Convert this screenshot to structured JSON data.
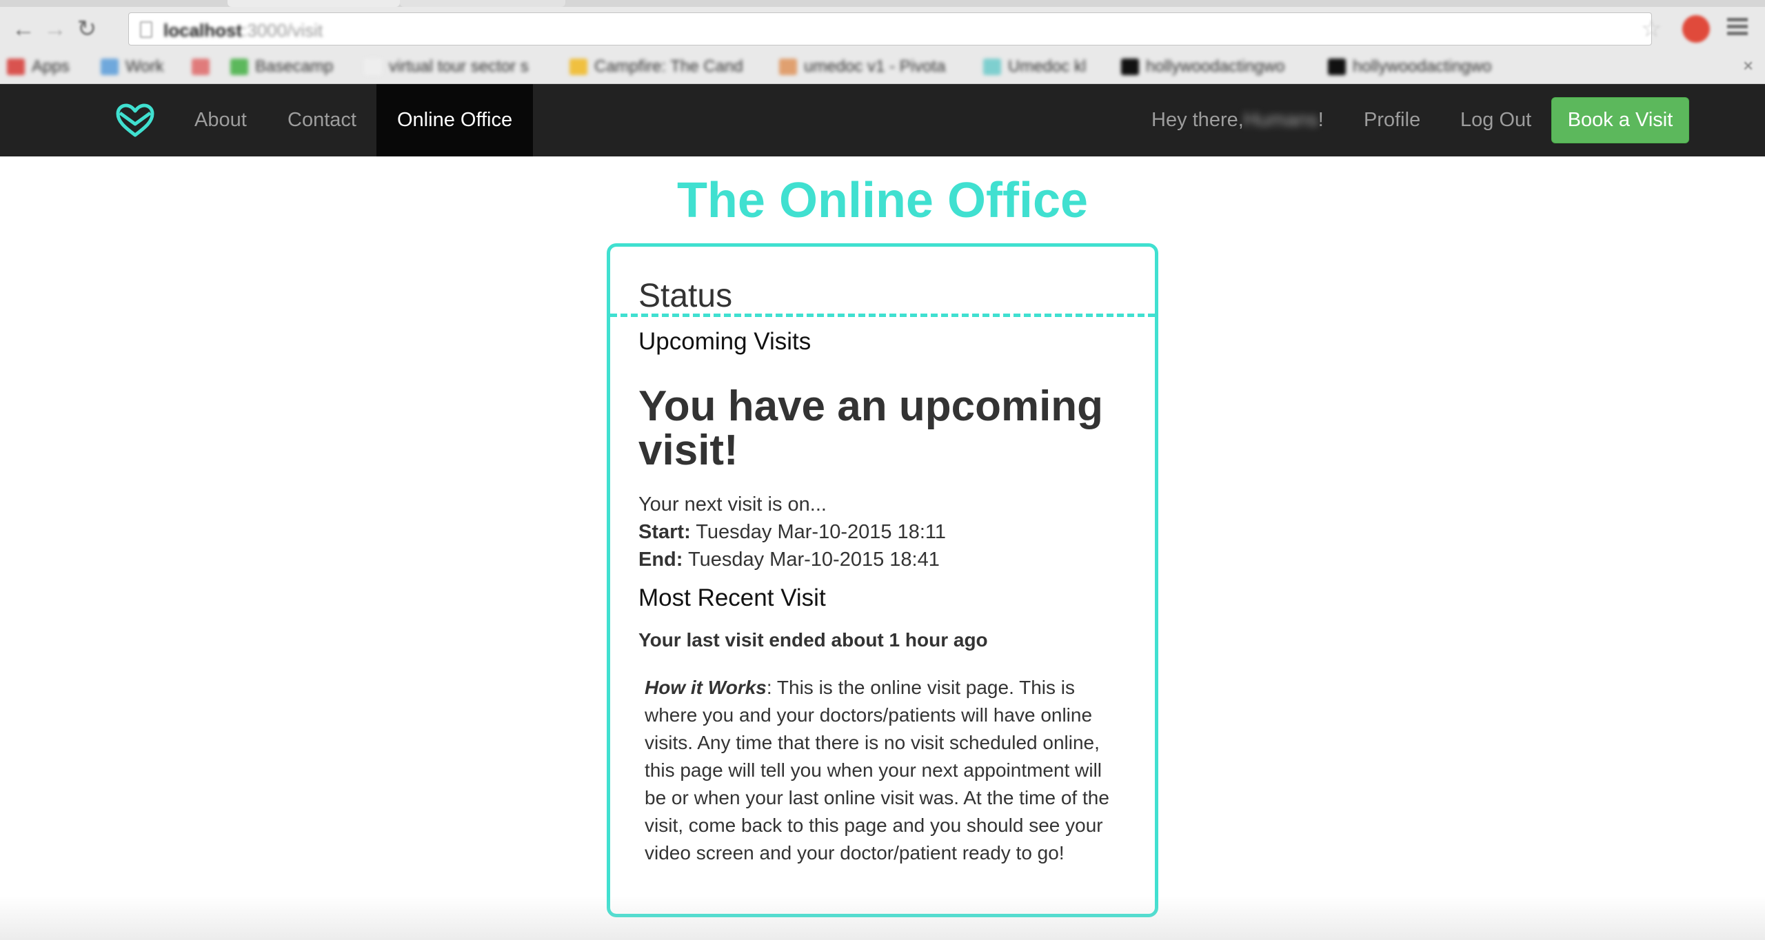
{
  "browser": {
    "url_host": "localhost",
    "url_path": ":3000/visit",
    "bookmarks": [
      {
        "label": "Apps",
        "color": "#d9534f"
      },
      {
        "label": "Work",
        "color": "#6fa8dc"
      },
      {
        "label": "",
        "color": "#e07b7b"
      },
      {
        "label": "Basecamp",
        "color": "#5cb85c"
      },
      {
        "label": "virtual tour sector s",
        "color": "#eeeeee"
      },
      {
        "label": "Campfire: The Cand",
        "color": "#f0c040"
      },
      {
        "label": "umedoc v1 - Pivota",
        "color": "#e0a070"
      },
      {
        "label": "Umedoc kl",
        "color": "#7ecfcf"
      },
      {
        "label": "hollywoodactingwo",
        "color": "#111111"
      },
      {
        "label": "hollywoodactingwo",
        "color": "#111111"
      }
    ]
  },
  "navbar": {
    "links": [
      {
        "label": "About"
      },
      {
        "label": "Contact"
      },
      {
        "label": "Online Office"
      }
    ],
    "greeting_prefix": "Hey there, ",
    "greeting_name": "Humans",
    "greeting_suffix": "!",
    "profile": "Profile",
    "logout": "Log Out",
    "book_button": "Book a Visit",
    "accent": "#40e0d0",
    "book_color": "#5cb85c"
  },
  "main": {
    "title": "The Online Office",
    "panel_heading": "Status",
    "upcoming_title": "Upcoming Visits",
    "headline": "You have an upcoming visit!",
    "next_intro": "Your next visit is on...",
    "start_label": "Start:",
    "start_value": " Tuesday Mar-10-2015 18:11",
    "end_label": "End:",
    "end_value": " Tuesday Mar-10-2015 18:41",
    "recent_title": "Most Recent Visit",
    "last_visit": "Your last visit ended about 1 hour ago",
    "how_label": "How it Works",
    "how_text": ": This is the online visit page. This is where you and your doctors/patients will have online visits. Any time that there is no visit scheduled online, this page will tell you when your next appointment will be or when your last online visit was. At the time of the visit, come back to this page and you should see your video screen and your doctor/patient ready to go!"
  }
}
